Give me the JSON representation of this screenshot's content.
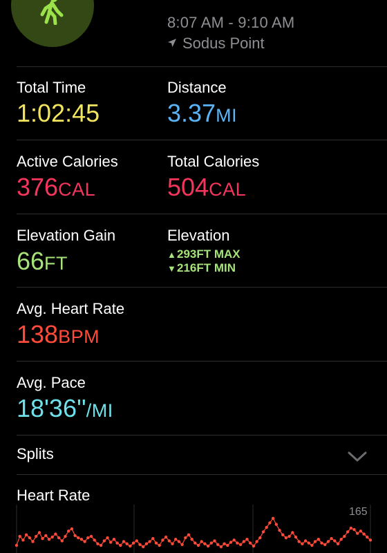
{
  "header": {
    "time_range": "8:07 AM - 9:10 AM",
    "location": "Sodus Point",
    "workout_icon": "walking-figure-icon",
    "location_icon": "location-arrow-icon",
    "icon_color": "#9be34a"
  },
  "metrics": {
    "total_time": {
      "label": "Total Time",
      "value": "1:02:45",
      "color": "#f2e45c"
    },
    "distance": {
      "label": "Distance",
      "value": "3.37",
      "unit": "MI",
      "color": "#5ab4f7"
    },
    "active_calories": {
      "label": "Active Calories",
      "value": "376",
      "unit": "CAL",
      "color": "#f5365c"
    },
    "total_calories": {
      "label": "Total Calories",
      "value": "504",
      "unit": "CAL",
      "color": "#f5365c"
    },
    "elevation_gain": {
      "label": "Elevation Gain",
      "value": "66",
      "unit": "FT",
      "color": "#a6e37a"
    },
    "elevation": {
      "label": "Elevation",
      "max": "293FT MAX",
      "min": "216FT MIN",
      "color": "#a6e37a"
    },
    "avg_heart_rate": {
      "label": "Avg. Heart Rate",
      "value": "138",
      "unit": "BPM",
      "color": "#ff4b3a"
    },
    "avg_pace": {
      "label": "Avg. Pace",
      "value": "18'36''",
      "unit": "/MI",
      "color": "#6fe1ea"
    }
  },
  "splits": {
    "label": "Splits",
    "icon": "chevron-down-icon"
  },
  "heart_rate": {
    "label": "Heart Rate",
    "max_tick": "165"
  },
  "chart_data": {
    "type": "line",
    "ylim": [
      90,
      175
    ],
    "yticks": [
      165
    ],
    "series": [
      {
        "color": "#ff4b3a",
        "values": [
          128,
          140,
          135,
          142,
          138,
          133,
          140,
          145,
          137,
          141,
          136,
          139,
          143,
          138,
          134,
          140,
          147,
          150,
          141,
          138,
          136,
          133,
          138,
          140,
          135,
          130,
          128,
          134,
          138,
          132,
          136,
          131,
          128,
          133,
          130,
          127,
          131,
          134,
          129,
          126,
          130,
          133,
          137,
          131,
          128,
          135,
          139,
          134,
          130,
          136,
          133,
          129,
          138,
          142,
          136,
          131,
          128,
          133,
          130,
          127,
          131,
          134,
          129,
          126,
          130,
          128,
          132,
          135,
          131,
          129,
          133,
          136,
          131,
          127,
          133,
          138,
          146,
          152,
          158,
          164,
          156,
          148,
          142,
          138,
          140,
          145,
          139,
          133,
          130,
          134,
          131,
          128,
          133,
          136,
          131,
          129,
          133,
          137,
          134,
          130,
          136,
          140,
          146,
          151,
          149,
          144,
          147,
          143,
          139,
          135
        ]
      }
    ]
  }
}
